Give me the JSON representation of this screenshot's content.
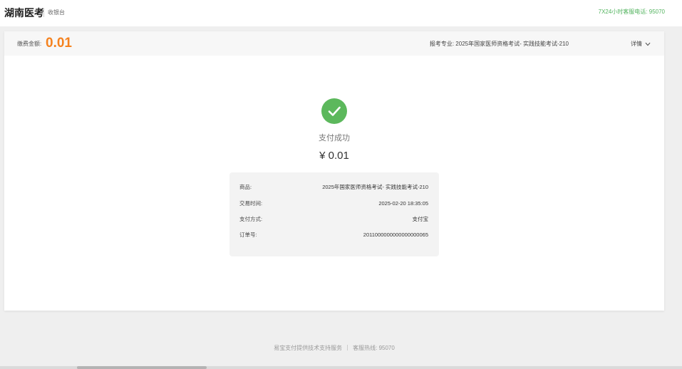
{
  "header": {
    "brand": "湖南医考",
    "subtitle": "收银台",
    "hotline": "7X24小时客服电话: 95070"
  },
  "summary": {
    "amount_label": "缴费金额:",
    "amount": "0.01",
    "major_label": "报考专业: ",
    "major": "2025年国家医师资格考试- 实践技能考试-210",
    "details_label": "详情"
  },
  "result": {
    "status": "支付成功",
    "amount": "¥ 0.01"
  },
  "order": {
    "rows": [
      {
        "label": "商品:",
        "value": "2025年国家医师资格考试- 实践技能考试-210"
      },
      {
        "label": "交易时间:",
        "value": "2025-02-20 18:35:05"
      },
      {
        "label": "支付方式:",
        "value": "支付宝"
      },
      {
        "label": "订单号:",
        "value": "2011000000000000000065"
      }
    ]
  },
  "footer": {
    "provider": "易宝支付提供技术支持服务",
    "hotline": "客服热线: 95070"
  },
  "colors": {
    "accent_orange": "#f5821f",
    "success_green": "#5cb85c",
    "hotline_green": "#52b35e"
  },
  "icons": {
    "success": "check-circle-icon",
    "details": "chevron-down-icon"
  }
}
